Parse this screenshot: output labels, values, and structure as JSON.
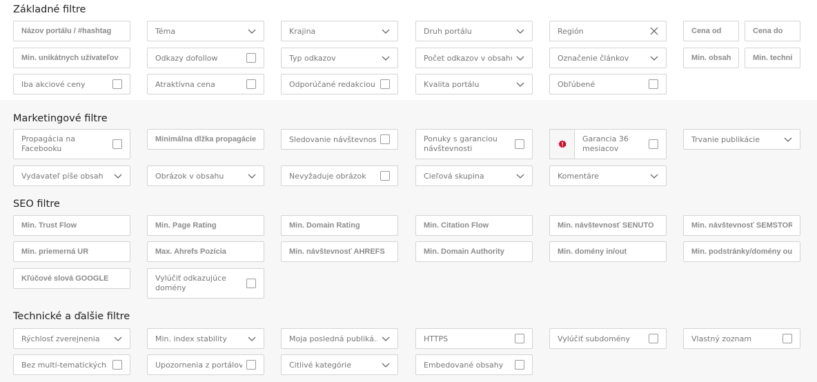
{
  "sections": {
    "basic": "Základné filtre",
    "marketing": "Marketingové filtre",
    "seo": "SEO filtre",
    "tech": "Technické a ďalšie filtre"
  },
  "basic": {
    "portal_name": "Názov portálu / #hashtag",
    "tema": "Téma",
    "krajina": "Krajina",
    "druh": "Druh portálu",
    "region": "Región",
    "cena_od": "Cena od",
    "cena_do": "Cena do",
    "min_users": "Min. unikátnych užívateľov",
    "dofollow": "Odkazy dofollow",
    "typ_odkazov": "Typ odkazov",
    "pocet_odkazov": "Počet odkazov v obsahu",
    "oznacenie": "Označenie článkov",
    "min_obsahu": "Min. obsahu",
    "min_techn": "Min. technickej",
    "akciove": "Iba akciové ceny",
    "atraktivna": "Atraktívna cena",
    "odporucane": "Odporúčané redakciou",
    "kvalita": "Kvalita portálu",
    "oblubene": "Obľúbené"
  },
  "marketing": {
    "facebook": "Propagácia na Facebooku",
    "min_dlzka": "Minimálna dĺžka propagácie",
    "sledovanie": "Sledovanie návštevnosti",
    "ponuky": "Ponuky s garanciou návštevnosti",
    "garancia": "Garancia 36 mesiacov",
    "trvanie": "Trvanie publikácie",
    "vydavatel": "Vydavateľ píše obsah",
    "obrazok": "Obrázok v obsahu",
    "nevyzaduje": "Nevyžaduje obrázok",
    "cielova": "Cieľová skupina",
    "komentare": "Komentáre"
  },
  "seo": {
    "trust_flow": "Min. Trust Flow",
    "page_rating": "Min. Page Rating",
    "domain_rating": "Min. Domain Rating",
    "citation_flow": "Min. Citation Flow",
    "senuto": "Min. návštevnosť SENUTO",
    "semstorm": "Min. návštevnosť SEMSTORM",
    "priemerna_ur": "Min. priemerná UR",
    "ahrefs_pozicia": "Max. Ahrefs Pozícia",
    "ahrefs": "Min. návštevnosť AHREFS",
    "domain_authority": "Min. Domain Authority",
    "domeny": "Min. domény in/out",
    "podstranky": "Min. podstránky/domény out",
    "klucove": "Kľúčové slová GOOGLE",
    "vylucit_domeny": "Vylúčiť odkazujúce domény"
  },
  "tech": {
    "rychlost": "Rýchlosť zverejnenia",
    "index": "Min. index stability",
    "posledna": "Moja posledná publiká...",
    "https": "HTTPS",
    "subdomeny": "Vylúčiť subdomény",
    "zoznam": "Vlastný zoznam",
    "multi": "Bez multi-tematických",
    "upozornenia": "Upozornenia z portálov",
    "citlive": "Citlivé kategórie",
    "embedovane": "Embedované obsahy"
  }
}
